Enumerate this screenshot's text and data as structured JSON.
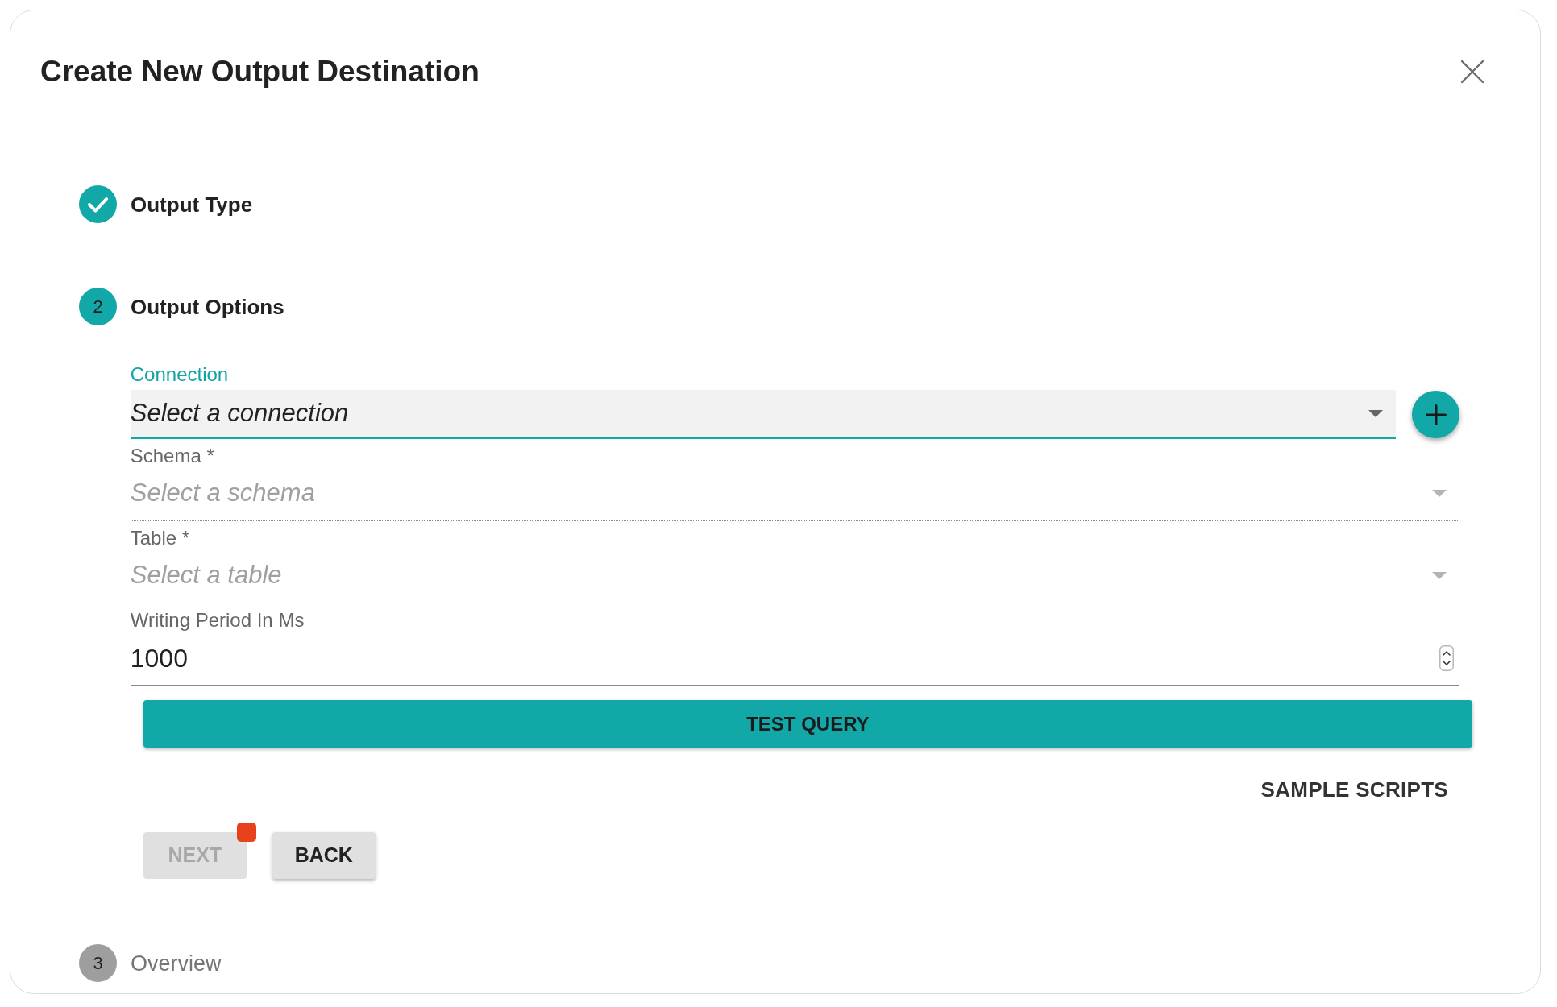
{
  "dialog": {
    "title": "Create New Output Destination"
  },
  "steps": [
    {
      "label": "Output Type",
      "completed": true,
      "active": false
    },
    {
      "number": "2",
      "label": "Output Options",
      "completed": false,
      "active": true,
      "form": {
        "fields": [
          {
            "kind": "select",
            "label": "Connection",
            "placeholder": "Select a connection",
            "focused": true,
            "add_button": true
          },
          {
            "kind": "select",
            "label": "Schema *",
            "placeholder": "Select a schema",
            "focused": false,
            "add_button": false
          },
          {
            "kind": "select",
            "label": "Table *",
            "placeholder": "Select a table",
            "focused": false,
            "add_button": false
          },
          {
            "kind": "number",
            "label": "Writing Period In Ms",
            "value": "1000",
            "focused": false
          }
        ],
        "test_button": {
          "label": "TEST QUERY"
        },
        "link_button": {
          "label": "SAMPLE SCRIPTS"
        },
        "actions": [
          {
            "label": "NEXT",
            "disabled": true,
            "alert": true
          },
          {
            "label": "BACK",
            "disabled": false,
            "alert": false
          }
        ]
      }
    },
    {
      "number": "3",
      "label": "Overview",
      "completed": false,
      "active": false
    }
  ]
}
